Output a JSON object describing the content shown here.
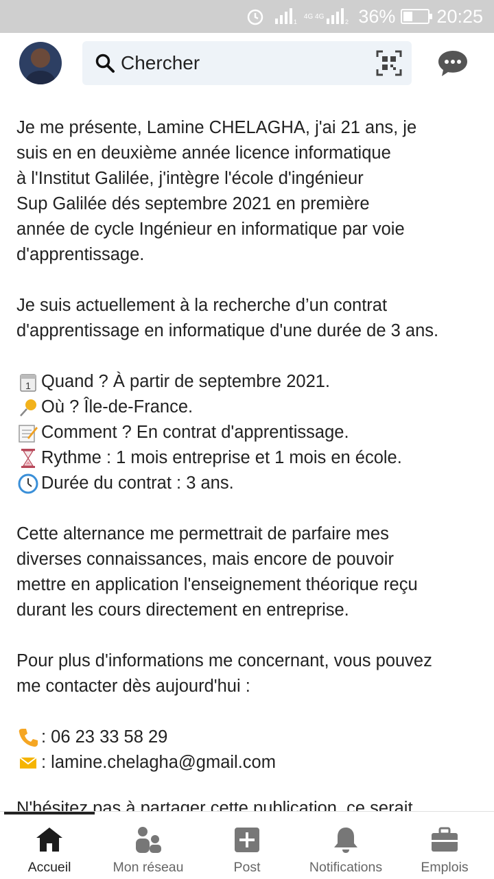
{
  "status_bar": {
    "network": "4G 4G",
    "battery": "36%",
    "battery_level": 0.36,
    "time": "20:25"
  },
  "header": {
    "search_placeholder": "Chercher"
  },
  "post": {
    "intro": "Je me présente, Lamine CHELAGHA, j'ai 21 ans, je\nsuis en en deuxième année licence informatique\nà l'Institut Galilée, j'intègre l'école d'ingénieur\nSup Galilée dés septembre 2021 en première\nannée de cycle Ingénieur en informatique par voie\nd'apprentissage.",
    "search_para": "Je suis actuellement à la recherche d’un contrat\nd'apprentissage en informatique d'une durée de 3 ans.",
    "details": [
      {
        "icon": "calendar-icon",
        "text": "Quand ? À partir de septembre 2021."
      },
      {
        "icon": "pin-icon",
        "text": "Où ? Île-de-France."
      },
      {
        "icon": "memo-icon",
        "text": "Comment ? En contrat d'apprentissage."
      },
      {
        "icon": "hourglass-icon",
        "text": " Rythme : 1 mois entreprise et 1 mois en école."
      },
      {
        "icon": "clock-icon",
        "text": " Durée du contrat : 3 ans."
      }
    ],
    "motivation": "Cette alternance me permettrait de parfaire mes\ndiverses connaissances, mais encore de pouvoir\nmettre en application l'enseignement théorique reçu\ndurant les cours directement en entreprise.",
    "contact_intro": "Pour plus d'informations me concernant, vous pouvez\nme contacter dès aujourd'hui :",
    "phone": " :  06 23 33 58 29",
    "email": " : lamine.chelagha@gmail.com",
    "cut_line": "N'hésitez pas à partager cette publication, ce serait"
  },
  "bottom_nav": {
    "items": [
      {
        "label": "Accueil",
        "icon": "home-icon",
        "active": true
      },
      {
        "label": "Mon réseau",
        "icon": "network-icon"
      },
      {
        "label": "Post",
        "icon": "post-icon"
      },
      {
        "label": "Notifications",
        "icon": "bell-icon"
      },
      {
        "label": "Emplois",
        "icon": "briefcase-icon"
      }
    ]
  }
}
